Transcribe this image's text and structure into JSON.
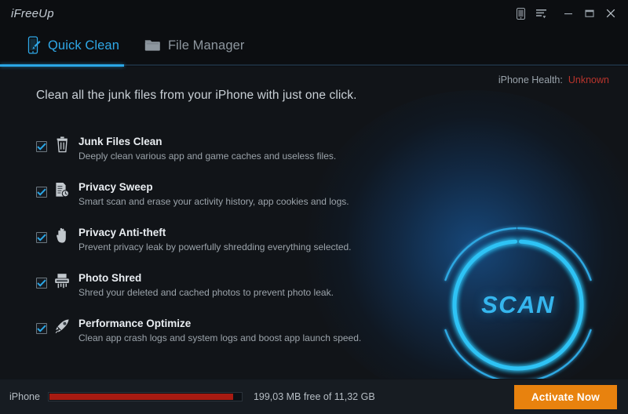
{
  "window": {
    "app_title": "iFreeUp",
    "controls": [
      {
        "name": "device-icon",
        "label": "Device"
      },
      {
        "name": "menu-icon",
        "label": "Menu"
      },
      {
        "name": "minimize-icon",
        "label": "Minimize"
      },
      {
        "name": "maximize-icon",
        "label": "Maximize"
      },
      {
        "name": "close-icon",
        "label": "Close"
      }
    ]
  },
  "tabs": [
    {
      "label": "Quick Clean",
      "icon": "phone-clean-icon",
      "active": true
    },
    {
      "label": "File Manager",
      "icon": "folder-icon",
      "active": false
    }
  ],
  "main": {
    "headline": "Clean all the junk files from your iPhone with just one click.",
    "health_label": "iPhone Health:",
    "health_value": "Unknown",
    "scan_label": "SCAN"
  },
  "features": [
    {
      "title": "Junk Files Clean",
      "desc": "Deeply clean various app and game caches and useless files.",
      "icon": "trash-icon",
      "checked": true
    },
    {
      "title": "Privacy Sweep",
      "desc": "Smart scan and erase your activity history, app cookies and logs.",
      "icon": "document-clock-icon",
      "checked": true
    },
    {
      "title": "Privacy Anti-theft",
      "desc": "Prevent privacy leak by powerfully shredding everything selected.",
      "icon": "hand-icon",
      "checked": true
    },
    {
      "title": "Photo Shred",
      "desc": "Shred your deleted and cached photos to prevent photo leak.",
      "icon": "shredder-icon",
      "checked": true
    },
    {
      "title": "Performance Optimize",
      "desc": "Clean app crash logs and system logs and boost app launch speed.",
      "icon": "rocket-icon",
      "checked": true
    }
  ],
  "statusbar": {
    "device_label": "iPhone",
    "storage_text": "199,03 MB free of 11,32 GB",
    "storage_used_percent": 96,
    "activate_label": "Activate Now"
  },
  "colors": {
    "accent_cyan": "#2aa6e6",
    "scan_cyan": "#35b6ee",
    "health_red": "#b8342c",
    "progress_red": "#a81b12",
    "activate_orange": "#e8820e",
    "window_bg": "#101216"
  }
}
